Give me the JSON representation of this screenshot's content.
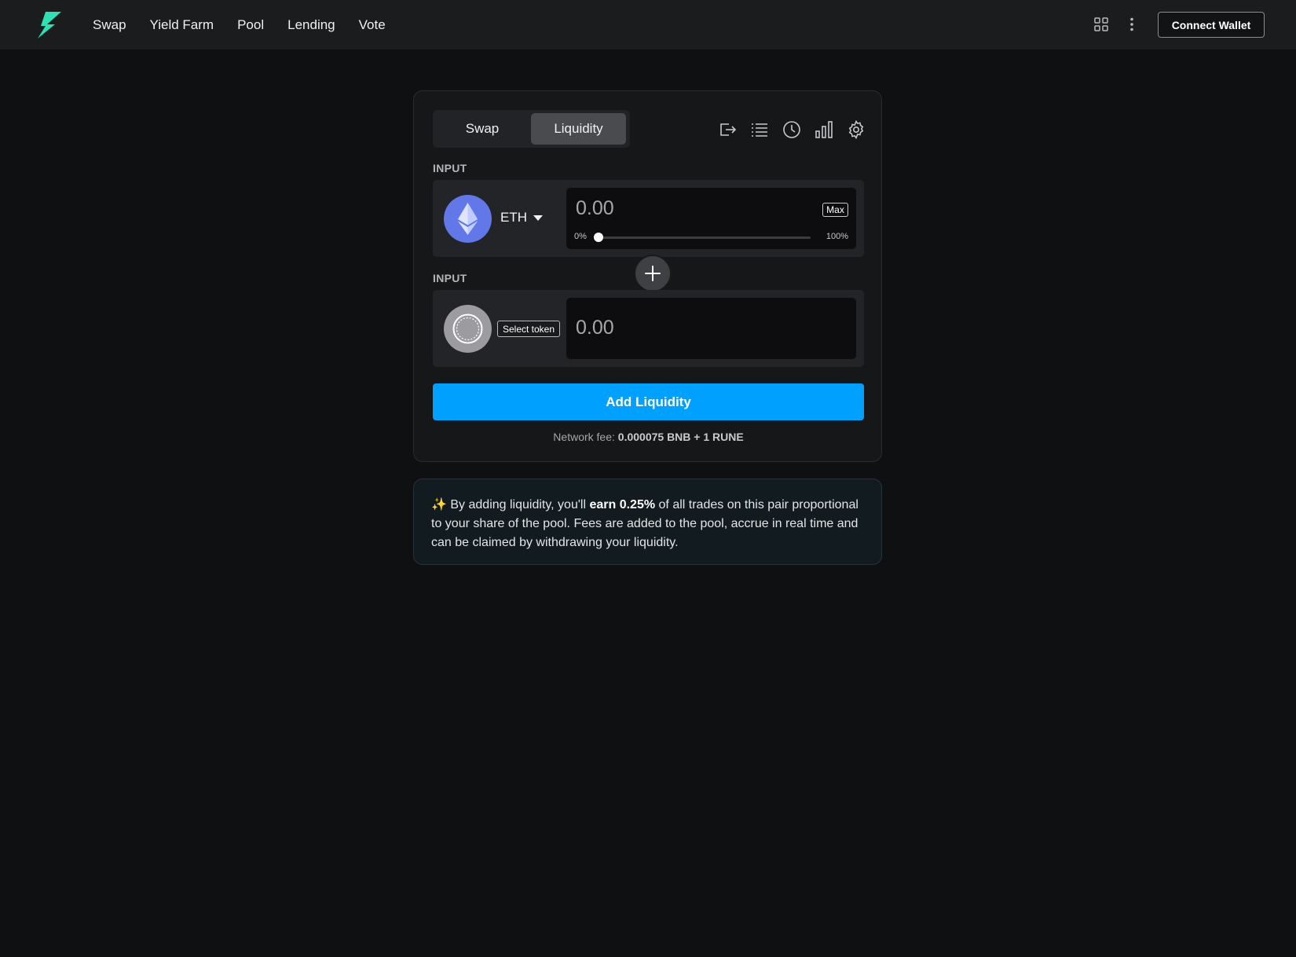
{
  "nav": {
    "items": [
      "Swap",
      "Yield Farm",
      "Pool",
      "Lending",
      "Vote"
    ]
  },
  "header": {
    "connect_wallet_label": "Connect Wallet",
    "icons": [
      "grid-icon",
      "kebab-menu-icon"
    ]
  },
  "card": {
    "tabs": [
      {
        "label": "Swap",
        "active": false
      },
      {
        "label": "Liquidity",
        "active": true
      }
    ],
    "toolbar_icons": [
      "withdraw-icon",
      "list-icon",
      "history-icon",
      "chart-icon",
      "settings-icon"
    ],
    "input1": {
      "label": "INPUT",
      "token": "ETH",
      "amount": "0.00",
      "max_label": "Max",
      "slider_min_label": "0%",
      "slider_max_label": "100%",
      "slider_value": 0
    },
    "input2": {
      "label": "INPUT",
      "select_token_label": "Select token",
      "amount": "0.00"
    },
    "add_liquidity_label": "Add Liquidity",
    "fee": {
      "prefix": "Network fee:",
      "value": "0.000075 BNB + 1 RUNE"
    }
  },
  "info": {
    "sparkle": "✨",
    "text_before": "By adding liquidity, you'll",
    "highlight": "earn 0.25%",
    "text_after": "of all trades on this pair proportional to your share of the pool. Fees are added to the pool, accrue in real time and can be claimed by withdrawing your liquidity."
  },
  "colors": {
    "background": "#0f1012",
    "topbar": "#1b1c1e",
    "accent": "#00a0ff",
    "logo": "#2fe0b5",
    "eth": "#6277e8"
  }
}
